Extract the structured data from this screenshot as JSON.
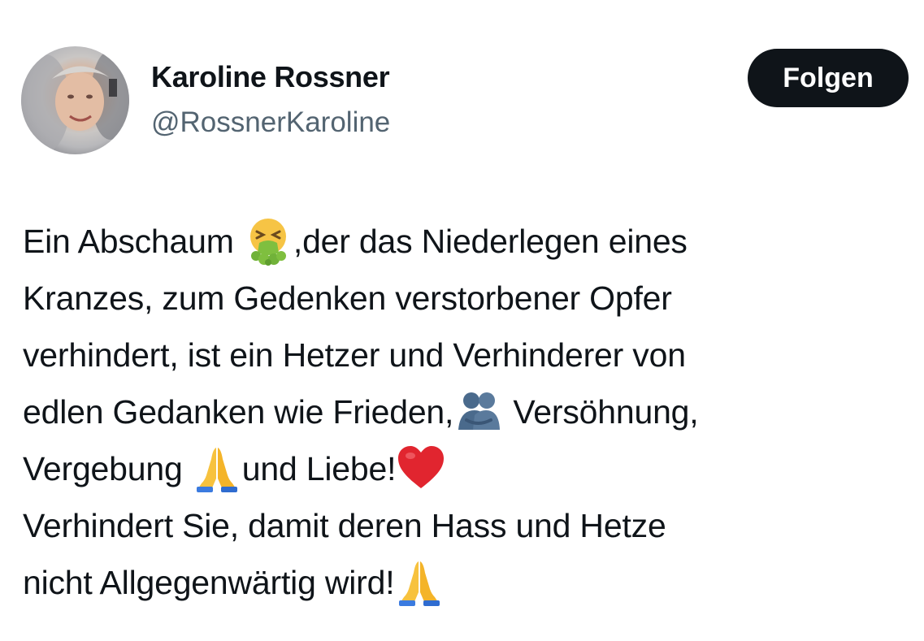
{
  "author": {
    "name": "Karoline Rossner",
    "handle": "@RossnerKaroline"
  },
  "follow_button": {
    "label": "Folgen"
  },
  "tweet": {
    "lines": [
      {
        "parts": [
          "Ein Abschaum ",
          ",der das Niederlegen eines"
        ]
      },
      {
        "parts": [
          "Kranzes, zum Gedenken verstorbener Opfer"
        ]
      },
      {
        "parts": [
          "verhindert, ist ein Hetzer und Verhinderer von"
        ]
      },
      {
        "parts": [
          "edlen Gedanken wie Frieden,",
          " Versöhnung,"
        ]
      },
      {
        "parts": [
          "Vergebung ",
          "und Liebe!"
        ]
      },
      {
        "parts": [
          "Verhindert Sie, damit deren Hass und Hetze"
        ]
      },
      {
        "parts": [
          "nicht Allgegenwärtig wird!"
        ]
      }
    ]
  },
  "icons": {
    "vomiting_face": "vomiting-face-emoji",
    "people_hugging": "people-hugging-emoji",
    "folded_hands": "folded-hands-emoji",
    "red_heart": "red-heart-emoji"
  },
  "colors": {
    "text": "#0f1419",
    "secondary_text": "#536471",
    "button_bg": "#0f1419",
    "button_text": "#ffffff"
  }
}
